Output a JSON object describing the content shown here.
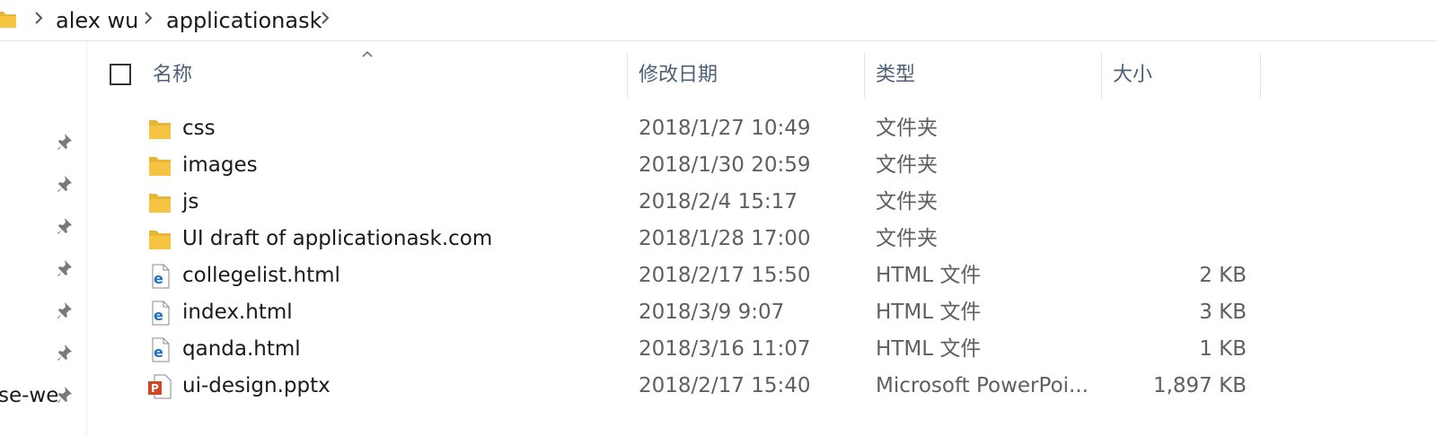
{
  "breadcrumb": {
    "items": [
      "alex wu",
      "applicationask"
    ]
  },
  "nav": {
    "partial_label": "se-we",
    "pin_count": 7
  },
  "columns": {
    "name": "名称",
    "date": "修改日期",
    "type": "类型",
    "size": "大小"
  },
  "files": [
    {
      "name": "css",
      "date": "2018/1/27 10:49",
      "type": "文件夹",
      "size": "",
      "icon": "folder-icon"
    },
    {
      "name": "images",
      "date": "2018/1/30 20:59",
      "type": "文件夹",
      "size": "",
      "icon": "folder-icon"
    },
    {
      "name": "js",
      "date": "2018/2/4 15:17",
      "type": "文件夹",
      "size": "",
      "icon": "folder-icon"
    },
    {
      "name": "UI draft of applicationask.com",
      "date": "2018/1/28 17:00",
      "type": "文件夹",
      "size": "",
      "icon": "folder-icon"
    },
    {
      "name": "collegelist.html",
      "date": "2018/2/17 15:50",
      "type": "HTML 文件",
      "size": "2 KB",
      "icon": "edge-html-icon"
    },
    {
      "name": "index.html",
      "date": "2018/3/9 9:07",
      "type": "HTML 文件",
      "size": "3 KB",
      "icon": "edge-html-icon"
    },
    {
      "name": "qanda.html",
      "date": "2018/3/16 11:07",
      "type": "HTML 文件",
      "size": "1 KB",
      "icon": "edge-html-icon"
    },
    {
      "name": "ui-design.pptx",
      "date": "2018/2/17 15:40",
      "type": "Microsoft PowerPoi...",
      "size": "1,897 KB",
      "icon": "powerpoint-icon"
    }
  ],
  "colors": {
    "header_text": "#4c6079",
    "folder": "#f5c542",
    "edge_blue": "#1f6fc5",
    "ppt_red": "#d24625"
  }
}
